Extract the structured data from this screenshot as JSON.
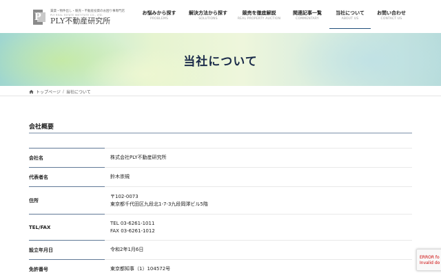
{
  "header": {
    "logo": {
      "tagline": "賃貸・物件出し・競売・不動産投資のお困り事専門店",
      "sub": "PLY REAL ESTATE INSTITUTE CO., LTD.",
      "name": "PLY不動産研究所"
    },
    "nav": [
      {
        "jp": "お悩みから探す",
        "en": "PROBLEMS"
      },
      {
        "jp": "解決方法から探す",
        "en": "SOLUTIONS"
      },
      {
        "jp": "競売を徹底解説",
        "en": "REAL PROPERTY AUCTION"
      },
      {
        "jp": "関連記事一覧",
        "en": "COMMENTARY"
      },
      {
        "jp": "当社について",
        "en": "ABOUT US"
      },
      {
        "jp": "お問い合わせ",
        "en": "CONTACT US"
      }
    ]
  },
  "hero": {
    "title": "当社について"
  },
  "breadcrumb": {
    "home": "トップページ",
    "current": "当社について"
  },
  "section": {
    "title": "会社概要"
  },
  "table": [
    {
      "label": "会社名",
      "lines": [
        "株式会社PLY不動産研究所"
      ]
    },
    {
      "label": "代表者名",
      "lines": [
        "鈴木崇規"
      ]
    },
    {
      "label": "住所",
      "lines": [
        "〒102-0073",
        "東京都千代田区九段北1-7-3九段岡澤ビル5階"
      ]
    },
    {
      "label": "TEL/FAX",
      "lines": [
        "TEL 03-6261-1011",
        "FAX 03-6261-1012"
      ]
    },
    {
      "label": "設立年月日",
      "lines": [
        "令和2年1月6日"
      ]
    },
    {
      "label": "免許番号",
      "lines": [
        "東京都知事（1）104572号"
      ]
    }
  ],
  "recaptcha": {
    "line1": "ERROR fo",
    "line2": "Invalid do"
  }
}
